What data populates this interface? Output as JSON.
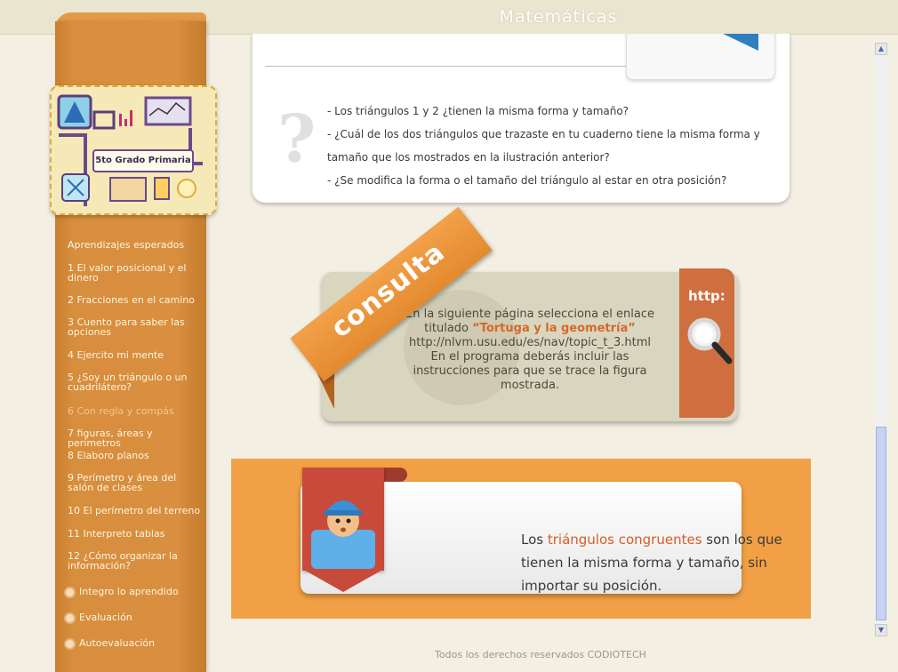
{
  "header": {
    "title": "Matemáticas"
  },
  "badge": {
    "title": "5to Grado Primaria"
  },
  "sidebar": {
    "items": [
      {
        "label": "Aprendizajes esperados",
        "top": 0
      },
      {
        "label": "1 El valor posicional y el dinero"
      },
      {
        "label": "2 Fracciones en el camino"
      },
      {
        "label": "3 Cuento para saber las opciones"
      },
      {
        "label": "4 Ejercito mi mente"
      },
      {
        "label": "5 ¿Soy un triángulo o un cuadrilátero?"
      },
      {
        "label": "6 Con regla y compás"
      },
      {
        "label": "7 figuras, áreas y perímetros"
      },
      {
        "label": "8 Elaboro planos"
      },
      {
        "label": "9 Perímetro y área del salón de clases"
      },
      {
        "label": "10 El perímetro del terreno"
      },
      {
        "label": "11 Interpreto tablas"
      },
      {
        "label": "12 ¿Cómo organizar la información?"
      },
      {
        "label": "Integro lo aprendido"
      },
      {
        "label": "Evaluación"
      },
      {
        "label": "Autoevaluación"
      }
    ]
  },
  "questions": {
    "q1": "- Los triángulos 1 y 2 ¿tienen la misma forma y tamaño?",
    "q2a": "- ¿Cuál de los dos triángulos que trazaste en tu cuaderno tiene la misma forma y",
    "q2b": "tamaño que los mostrados en la ilustración anterior?",
    "q3": "- ¿Se modifica la forma o el tamaño del triángulo al estar en otra posición?"
  },
  "consulta": {
    "ribbon": "consulta",
    "http_label": "http:",
    "line1": "En la siguiente página selecciona el enlace",
    "titled": "titulado ",
    "link": "“Tortuga y la geometría”",
    "url": "http://nlvm.usu.edu/es/nav/topic_t_3.html",
    "line4": "En el programa deberás incluir las",
    "line5": "instrucciones para que se trace la figura",
    "line6": "mostrada."
  },
  "definition": {
    "pre": "Los ",
    "term": "triángulos congruentes",
    "post": " son los que tienen la misma forma y tamaño, sin importar su posición."
  },
  "footer": {
    "text": "Todos los derechos reservados CODIOTECH"
  },
  "colors": {
    "accent": "#d98f3f",
    "ribbon": "#e38a2e",
    "http_tab": "#cf6e3f",
    "banner": "#c84a3a"
  }
}
